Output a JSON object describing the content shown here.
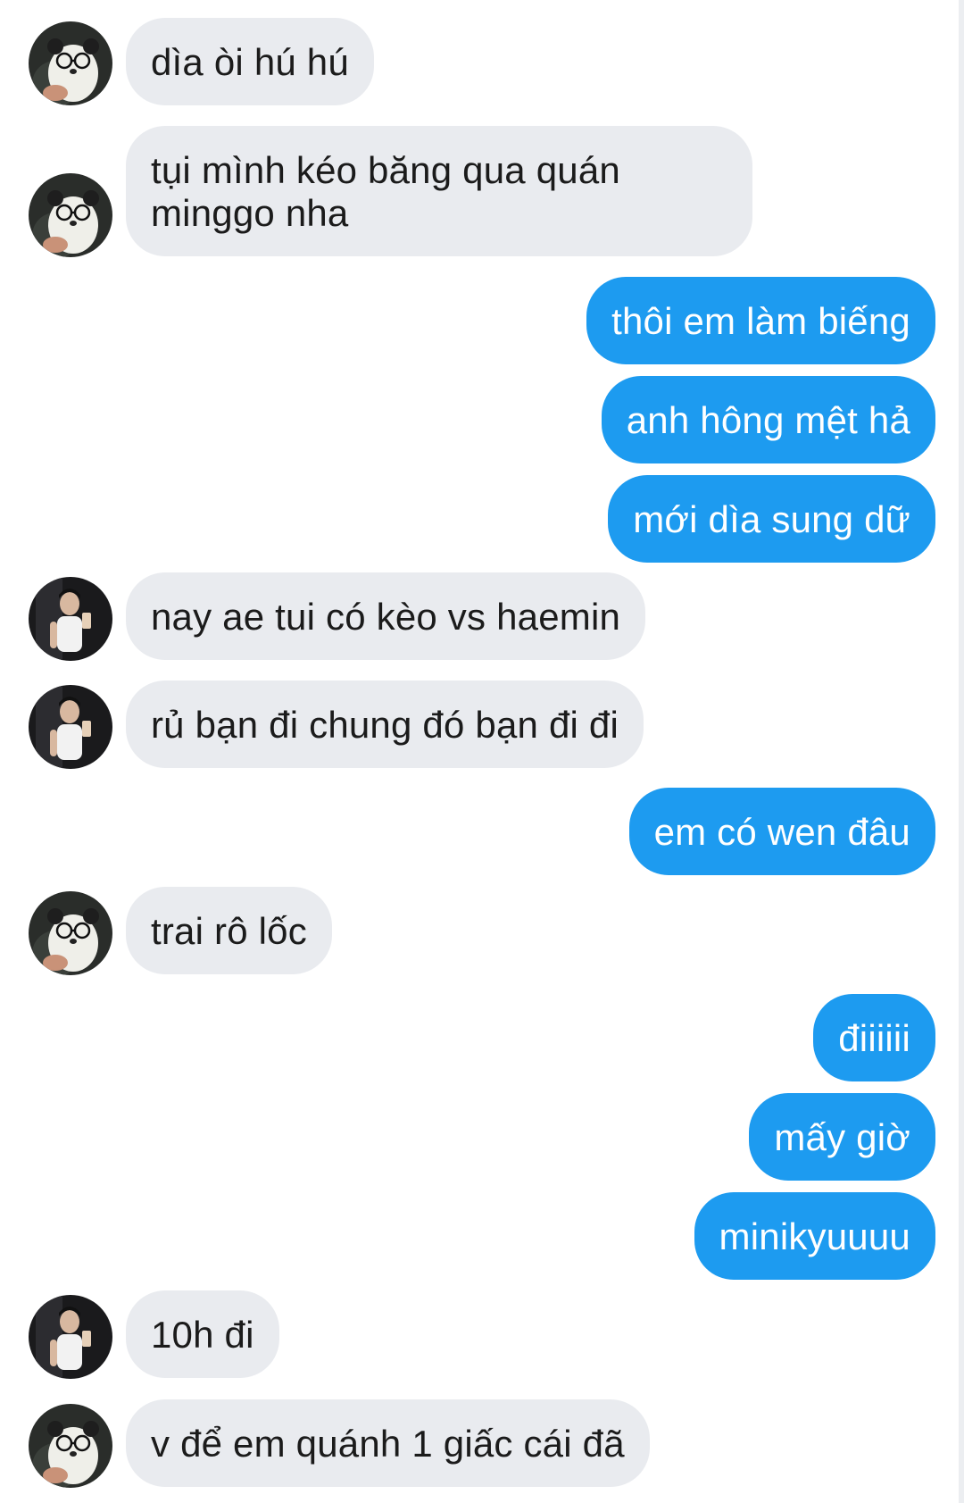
{
  "conversation": {
    "messages": [
      {
        "sender": "friend-a",
        "direction": "incoming",
        "text": "dìa òi hú hú"
      },
      {
        "sender": "friend-a",
        "direction": "incoming",
        "text": "tụi mình kéo băng qua quán minggo nha"
      },
      {
        "sender": "me",
        "direction": "outgoing",
        "text": "thôi em làm biếng"
      },
      {
        "sender": "me",
        "direction": "outgoing",
        "text": "anh hông mệt hả"
      },
      {
        "sender": "me",
        "direction": "outgoing",
        "text": "mới dìa sung dữ"
      },
      {
        "sender": "friend-b",
        "direction": "incoming",
        "text": "nay ae tui có kèo vs haemin"
      },
      {
        "sender": "friend-b",
        "direction": "incoming",
        "text": "rủ bạn đi chung đó bạn đi đi"
      },
      {
        "sender": "me",
        "direction": "outgoing",
        "text": "em có wen đâu"
      },
      {
        "sender": "friend-a",
        "direction": "incoming",
        "text": "trai rô lốc"
      },
      {
        "sender": "me",
        "direction": "outgoing",
        "text": "điiiiii"
      },
      {
        "sender": "me",
        "direction": "outgoing",
        "text": "mấy giờ"
      },
      {
        "sender": "me",
        "direction": "outgoing",
        "text": "minikyuuuu"
      },
      {
        "sender": "friend-b",
        "direction": "incoming",
        "text": "10h đi"
      },
      {
        "sender": "friend-a",
        "direction": "incoming",
        "text": "v để em quánh 1 giấc cái đã"
      }
    ]
  },
  "colors": {
    "outgoing_bubble": "#1d9bf0",
    "incoming_bubble": "#e9ebef",
    "outgoing_text": "#ffffff",
    "incoming_text": "#1b1b1b",
    "background": "#ffffff"
  },
  "icons": {
    "friend_a_avatar": "bear-mascot-avatar-icon",
    "friend_b_avatar": "mirror-selfie-avatar-icon"
  }
}
